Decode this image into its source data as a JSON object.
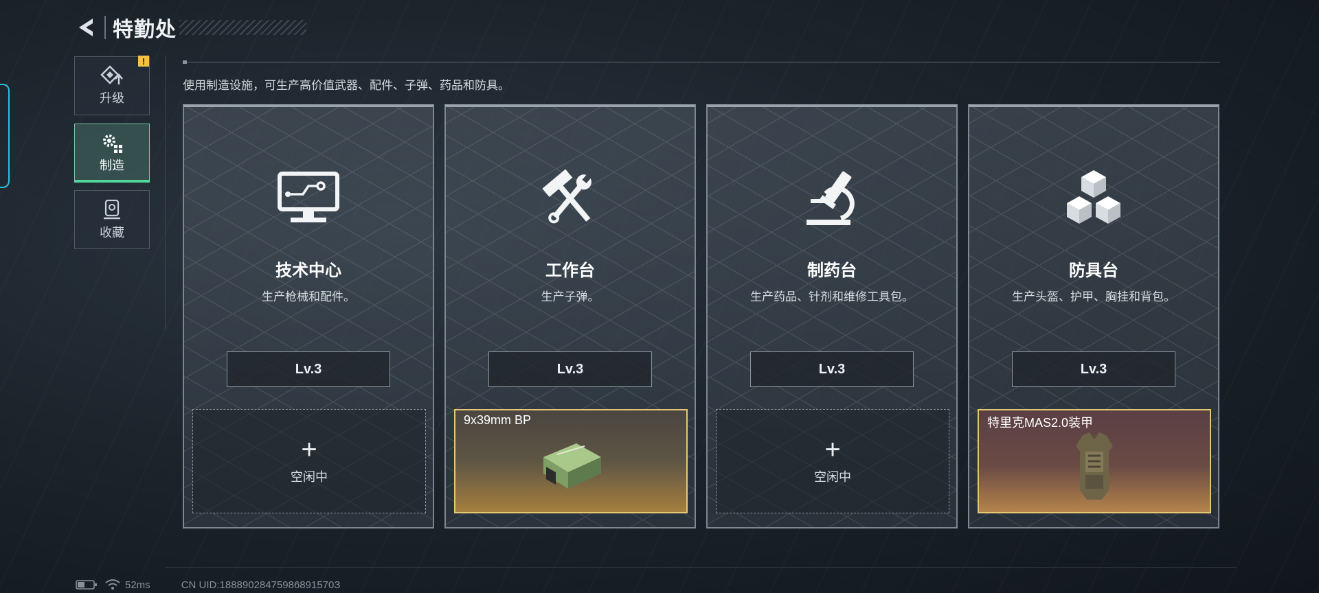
{
  "header": {
    "title": "特勤处",
    "back_icon": "back-arrow-icon"
  },
  "sidebar": {
    "tabs": [
      {
        "label": "升级",
        "icon": "upgrade-icon",
        "alert": "!"
      },
      {
        "label": "制造",
        "icon": "gears-icon",
        "active": true
      },
      {
        "label": "收藏",
        "icon": "collection-icon"
      }
    ]
  },
  "description": "使用制造设施，可生产高价值武器、配件、子弹、药品和防具。",
  "stations": [
    {
      "name": "技术中心",
      "desc": "生产枪械和配件。",
      "level": "Lv.3",
      "icon": "computer-icon",
      "slot": {
        "state": "idle",
        "plus": "+",
        "text": "空闲中"
      }
    },
    {
      "name": "工作台",
      "desc": "生产子弹。",
      "level": "Lv.3",
      "icon": "hammer-wrench-icon",
      "slot": {
        "state": "producing",
        "item_name": "9x39mm BP"
      }
    },
    {
      "name": "制药台",
      "desc": "生产药品、针剂和维修工具包。",
      "level": "Lv.3",
      "icon": "microscope-icon",
      "slot": {
        "state": "idle",
        "plus": "+",
        "text": "空闲中"
      }
    },
    {
      "name": "防具台",
      "desc": "生产头盔、护甲、胸挂和背包。",
      "level": "Lv.3",
      "icon": "cubes-icon",
      "slot": {
        "state": "producing",
        "item_name": "特里克MAS2.0装甲"
      }
    }
  ],
  "footer": {
    "ping": "52ms",
    "uid": "CN UID:18889028475986891570З"
  },
  "colors": {
    "accent_green": "#52d69a",
    "alert_yellow": "#f0c341",
    "item_border": "#e6c874"
  }
}
